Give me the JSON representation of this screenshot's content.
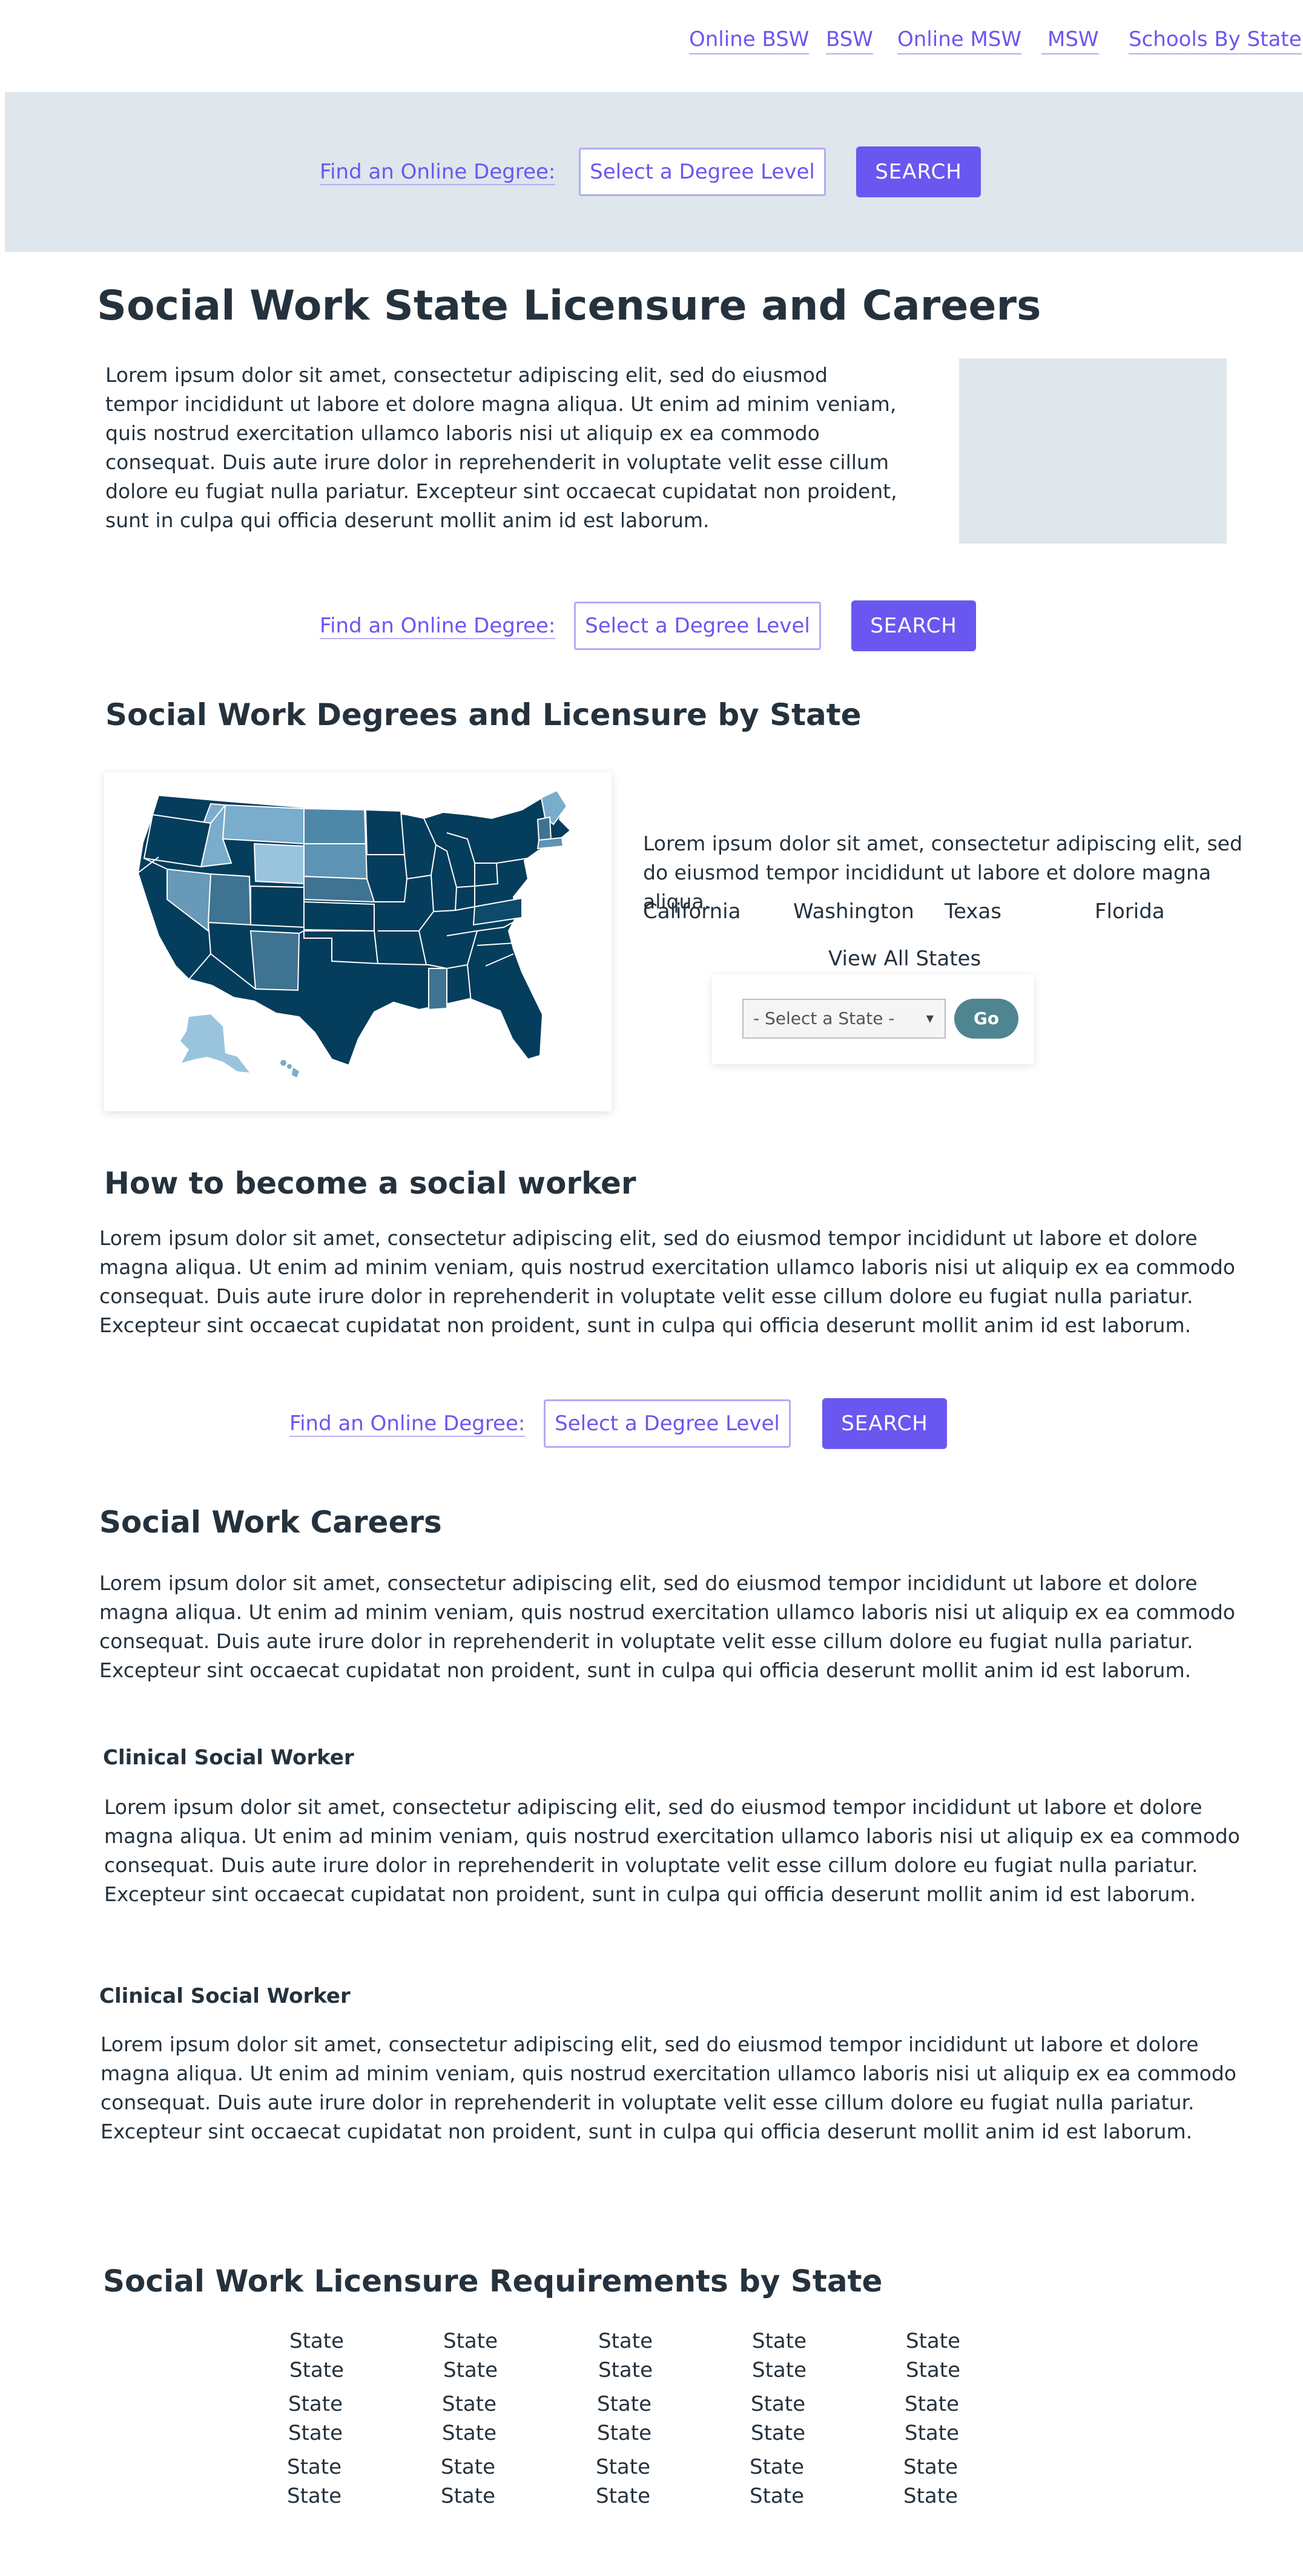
{
  "nav": {
    "links": [
      "Online BSW",
      "BSW",
      "Online MSW",
      "MSW",
      "Schools By State"
    ]
  },
  "search": {
    "label": "Find an Online Degree:",
    "select_placeholder": "Select a Degree Level",
    "button_label": "SEARCH"
  },
  "page": {
    "title": "Social Work State Licensure and Careers",
    "intro": "Lorem ipsum dolor sit amet, consectetur adipiscing elit, sed do eiusmod tempor incididunt ut labore et dolore magna aliqua. Ut enim ad minim veniam, quis nostrud exercitation ullamco laboris nisi ut aliquip ex ea commodo consequat. Duis aute irure dolor in reprehenderit in voluptate velit esse cillum dolore eu fugiat nulla pariatur. Excepteur sint occaecat cupidatat non proident, sunt in culpa qui officia deserunt mollit anim id est laborum."
  },
  "by_state": {
    "heading": "Social Work Degrees and Licensure by State",
    "text": "Lorem ipsum dolor sit amet, consectetur adipiscing elit, sed do eiusmod tempor incididunt ut labore et dolore magna aliqua.",
    "states": [
      "California",
      "Washington",
      "Texas",
      "Florida"
    ],
    "view_all": "View All States",
    "select_placeholder": "- Select a State -",
    "go_label": "Go"
  },
  "become": {
    "heading": "How to become a social worker",
    "text": "Lorem ipsum dolor sit amet, consectetur adipiscing elit, sed do eiusmod tempor incididunt ut labore et dolore magna aliqua. Ut enim ad minim veniam, quis nostrud exercitation ullamco laboris nisi ut aliquip ex ea commodo consequat. Duis aute irure dolor in reprehenderit in voluptate velit esse cillum dolore eu fugiat nulla pariatur. Excepteur sint occaecat cupidatat non proident, sunt in culpa qui officia deserunt mollit anim id est laborum."
  },
  "careers": {
    "heading": "Social Work Careers",
    "text": "Lorem ipsum dolor sit amet, consectetur adipiscing elit, sed do eiusmod tempor incididunt ut labore et dolore magna aliqua. Ut enim ad minim veniam, quis nostrud exercitation ullamco laboris nisi ut aliquip ex ea commodo consequat. Duis aute irure dolor in reprehenderit in voluptate velit esse cillum dolore eu fugiat nulla pariatur. Excepteur sint occaecat cupidatat non proident, sunt in culpa qui officia deserunt mollit anim id est laborum.",
    "items": [
      {
        "title": "Clinical Social Worker",
        "text": "Lorem ipsum dolor sit amet, consectetur adipiscing elit, sed do eiusmod tempor incididunt ut labore et dolore magna aliqua. Ut enim ad minim veniam, quis nostrud exercitation ullamco laboris nisi ut aliquip ex ea commodo consequat. Duis aute irure dolor in reprehenderit in voluptate velit esse cillum dolore eu fugiat nulla pariatur. Excepteur sint occaecat cupidatat non proident, sunt in culpa qui officia deserunt mollit anim id est laborum."
      },
      {
        "title": "Clinical Social Worker",
        "text": "Lorem ipsum dolor sit amet, consectetur adipiscing elit, sed do eiusmod tempor incididunt ut labore et dolore magna aliqua. Ut enim ad minim veniam, quis nostrud exercitation ullamco laboris nisi ut aliquip ex ea commodo consequat. Duis aute irure dolor in reprehenderit in voluptate velit esse cillum dolore eu fugiat nulla pariatur. Excepteur sint occaecat cupidatat non proident, sunt in culpa qui officia deserunt mollit anim id est laborum."
      }
    ]
  },
  "requirements": {
    "heading": "Social Work Licensure Requirements by State",
    "cell_label": "State",
    "rows": 6,
    "cols": 5
  },
  "colors": {
    "accent": "#6a57f0",
    "heading": "#25323d",
    "band": "#dfe6ec",
    "map_dark": "#053d5c",
    "map_mid": "#3e7391",
    "map_light": "#7aaccb",
    "go_button": "#4f8590"
  }
}
